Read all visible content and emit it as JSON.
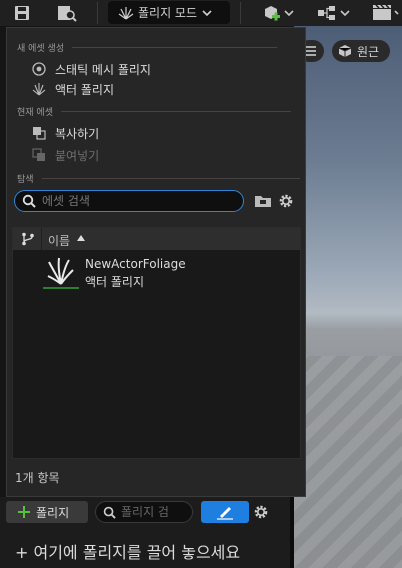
{
  "toolbar": {
    "mode_label": "폴리지 모드",
    "icons": [
      "save-icon",
      "browse-icon",
      "foliage-icon",
      "add-actor-icon",
      "blueprint-icon",
      "cinematics-icon"
    ]
  },
  "viewport": {
    "perspective_label": "원근"
  },
  "menu": {
    "sections": {
      "new_asset": "새 에셋 생성",
      "current_asset": "현재 에셋",
      "browse": "탐색"
    },
    "items": {
      "static_mesh_foliage": "스태틱 메시 폴리지",
      "actor_foliage": "액터 폴리지",
      "copy": "복사하기",
      "paste": "붙여넣기"
    },
    "search": {
      "placeholder": "에셋 검색",
      "value": ""
    },
    "list": {
      "column_name": "이름",
      "rows": [
        {
          "name": "NewActorFoliage",
          "type": "액터 폴리지"
        }
      ]
    },
    "item_count": "1개 항목"
  },
  "foliage_panel": {
    "add_button": "폴리지",
    "search_placeholder": "폴리지 검",
    "drop_hint": "+ 여기에 폴리지를 끌어 놓으세요"
  },
  "colors": {
    "accent": "#2f86d8",
    "paint_button": "#1e7fe0",
    "add_green": "#58c23c",
    "row_bar": "#2e7d32"
  }
}
